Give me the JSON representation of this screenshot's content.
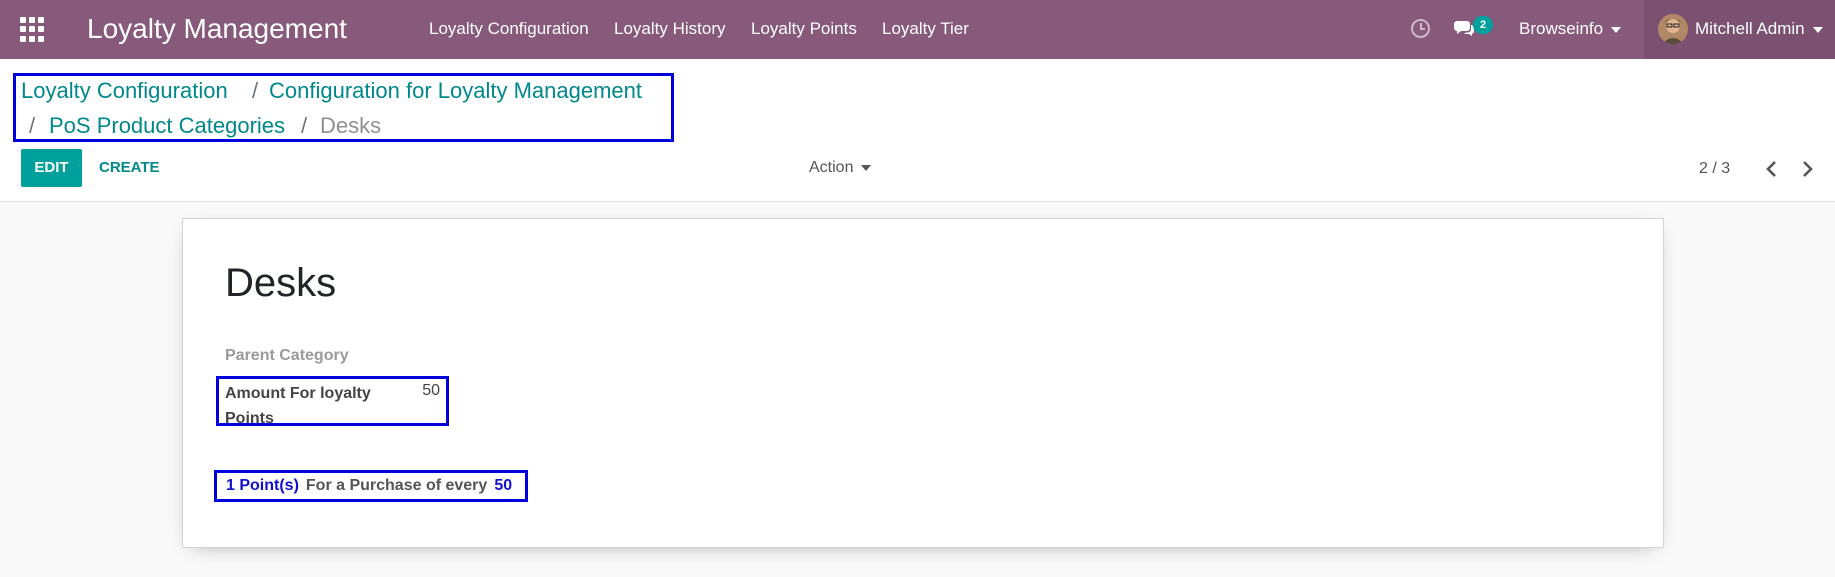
{
  "navbar": {
    "app_title": "Loyalty Management",
    "menu": [
      "Loyalty Configuration",
      "Loyalty History",
      "Loyalty Points",
      "Loyalty Tier"
    ],
    "chat_count": "2",
    "company": "Browseinfo",
    "user": "Mitchell Admin",
    "colors": {
      "bar": "#875a7b",
      "accent": "#00a09d"
    }
  },
  "breadcrumb": {
    "items": [
      "Loyalty Configuration",
      "Configuration for Loyalty Management",
      "PoS Product Categories",
      "Desks"
    ],
    "separator": "/"
  },
  "toolbar": {
    "edit_label": "EDIT",
    "create_label": "CREATE",
    "action_label": "Action",
    "pager": "2 / 3"
  },
  "form": {
    "name": "Desks",
    "parent_category_label": "Parent Category",
    "amount_label": "Amount For loyalty Points",
    "amount_value": "50",
    "points_summary": {
      "points": "1 Point(s)",
      "text": "For a Purchase of every",
      "amount": "50"
    }
  }
}
